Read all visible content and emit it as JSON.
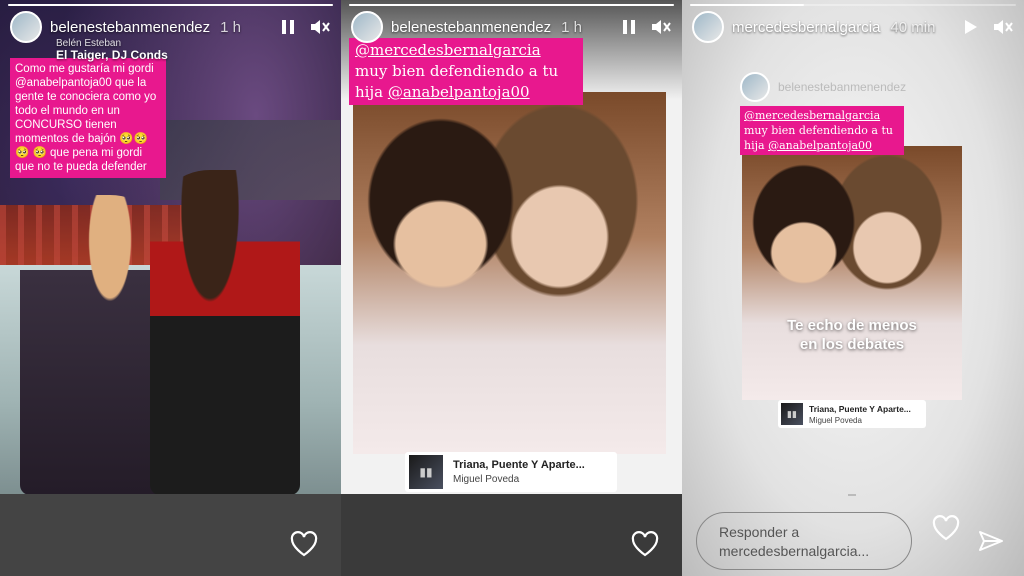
{
  "panels": [
    {
      "username": "belenestebanmenendez",
      "time": "1 h",
      "subhead_super": "Belén Esteban",
      "subhead": "El Taiger, DJ Conds",
      "caption": "Como me gustaría mi gordi @anabelpantoja00 que la gente te conociera como yo todo el mundo en un CONCURSO tienen momentos de bajón 🥺🥺🥺 🥺 que pena mi gordi que no te pueda defender",
      "progress": 1.0,
      "icons": [
        "pause-icon",
        "mute-icon",
        "heart-icon"
      ]
    },
    {
      "username": "belenestebanmenendez",
      "time": "1 h",
      "caption_prefix": "@mercedesbernalgarcia",
      "caption_middle": " muy bien defendiendo a tu hija ",
      "caption_mention": "@anabelpantoja00",
      "music_title": "Triana, Puente Y Aparte...",
      "music_artist": "Miguel Poveda",
      "progress": 1.0,
      "icons": [
        "pause-icon",
        "mute-icon",
        "heart-icon"
      ]
    },
    {
      "username": "mercedesbernalgarcia",
      "time": "40 min",
      "inner_username": "belenestebanmenendez",
      "caption_prefix": "@mercedesbernalgarcia",
      "caption_middle": " muy bien defendiendo a tu hija ",
      "caption_mention": "@anabelpantoja00",
      "sticker_line1": "Te echo de menos",
      "sticker_line2": "en los debates",
      "music_title": "Triana, Puente Y Aparte...",
      "music_artist": "Miguel Poveda",
      "reply_placeholder": "Responder a mercedesbernalgarcia...",
      "progress": 0.35,
      "icons": [
        "play-icon",
        "mute-icon",
        "heart-icon",
        "send-icon"
      ]
    }
  ],
  "colors": {
    "accent_pink": "#e8188e"
  }
}
